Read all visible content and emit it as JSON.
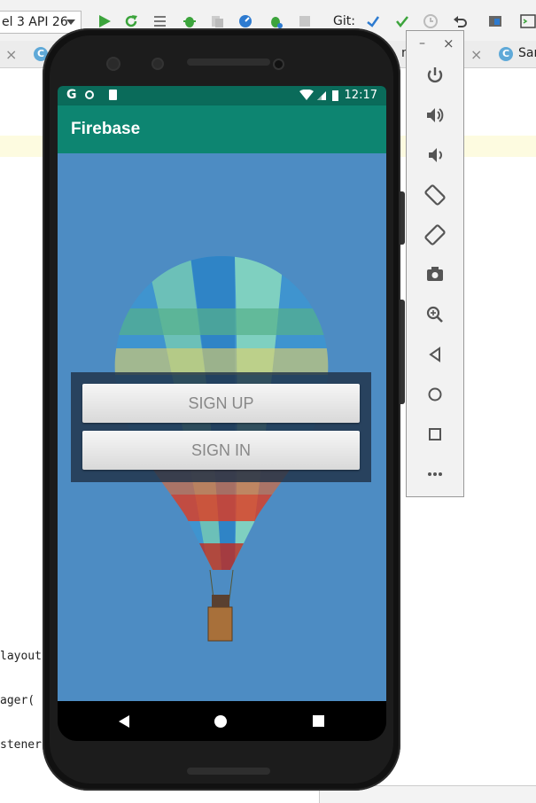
{
  "ide": {
    "device_label": "el 3 API 26",
    "git_label": "Git:",
    "tabs": [
      {
        "text": "nd"
      },
      {
        "text": "Sar"
      }
    ],
    "code_lines": [
      "layout",
      "ager(",
      "stener"
    ]
  },
  "phone": {
    "status_time": "12:17",
    "status_g": "G",
    "app_title": "Firebase",
    "buttons": {
      "sign_up": "SIGN UP",
      "sign_in": "SIGN IN"
    }
  },
  "emulator_panel": {
    "minimize": "–",
    "close": "×",
    "controls": [
      "power-icon",
      "volume-up-icon",
      "volume-down-icon",
      "rotate-left-icon",
      "rotate-right-icon",
      "camera-icon",
      "zoom-icon",
      "back-icon",
      "home-icon",
      "overview-icon",
      "more-icon"
    ]
  },
  "colors": {
    "status_bar": "#0a6b5a",
    "app_bar": "#0d8571",
    "sky": "#4d8cc3"
  }
}
